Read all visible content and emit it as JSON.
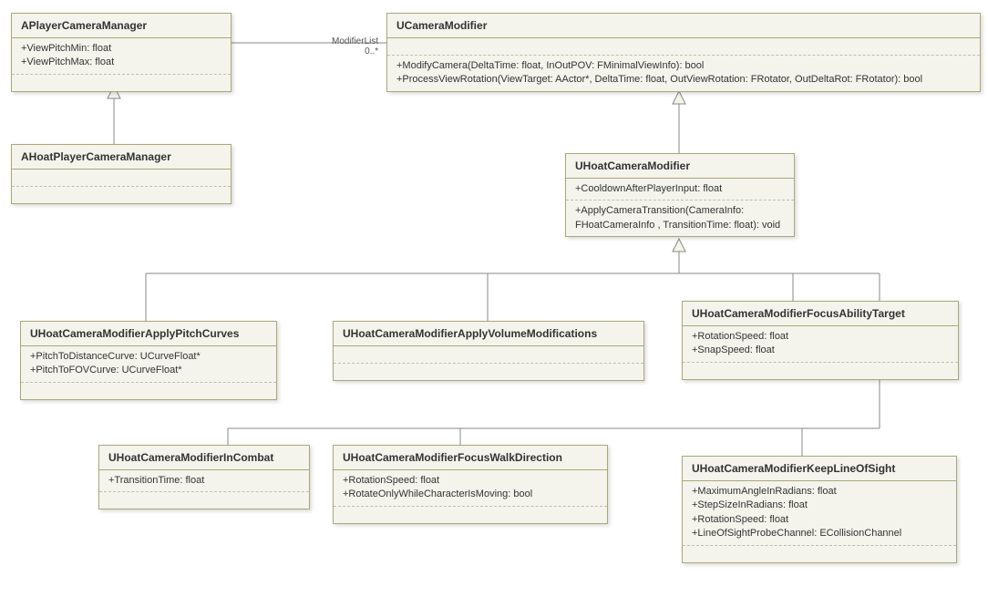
{
  "assoc": {
    "modifierList": "ModifierList",
    "mult": "0..*"
  },
  "classes": {
    "apcm": {
      "name": "APlayerCameraManager",
      "attrs": [
        "+ViewPitchMin: float",
        "+ViewPitchMax: float"
      ]
    },
    "ucm": {
      "name": "UCameraModifier",
      "ops": [
        "+ModifyCamera(DeltaTime: float, InOutPOV: FMinimalViewInfo): bool",
        "+ProcessViewRotation(ViewTarget: AActor*, DeltaTime: float, OutViewRotation: FRotator, OutDeltaRot: FRotator): bool"
      ]
    },
    "ahpcm": {
      "name": "AHoatPlayerCameraManager"
    },
    "uhcm": {
      "name": "UHoatCameraModifier",
      "attrs": [
        "+CooldownAfterPlayerInput: float"
      ],
      "ops": [
        "+ApplyCameraTransition(CameraInfo:",
        "FHoatCameraInfo , TransitionTime: float): void"
      ]
    },
    "pitch": {
      "name": "UHoatCameraModifierApplyPitchCurves",
      "attrs": [
        "+PitchToDistanceCurve: UCurveFloat*",
        "+PitchToFOVCurve: UCurveFloat*"
      ]
    },
    "vol": {
      "name": "UHoatCameraModifierApplyVolumeModifications"
    },
    "focusAbility": {
      "name": "UHoatCameraModifierFocusAbilityTarget",
      "attrs": [
        "+RotationSpeed: float",
        "+SnapSpeed: float"
      ]
    },
    "combat": {
      "name": "UHoatCameraModifierInCombat",
      "attrs": [
        "+TransitionTime: float"
      ]
    },
    "walk": {
      "name": "UHoatCameraModifierFocusWalkDirection",
      "attrs": [
        "+RotationSpeed: float",
        "+RotateOnlyWhileCharacterIsMoving: bool"
      ]
    },
    "los": {
      "name": "UHoatCameraModifierKeepLineOfSight",
      "attrs": [
        "+MaximumAngleInRadians: float",
        "+StepSizeInRadians: float",
        "+RotationSpeed: float",
        "+LineOfSightProbeChannel: ECollisionChannel"
      ]
    }
  }
}
